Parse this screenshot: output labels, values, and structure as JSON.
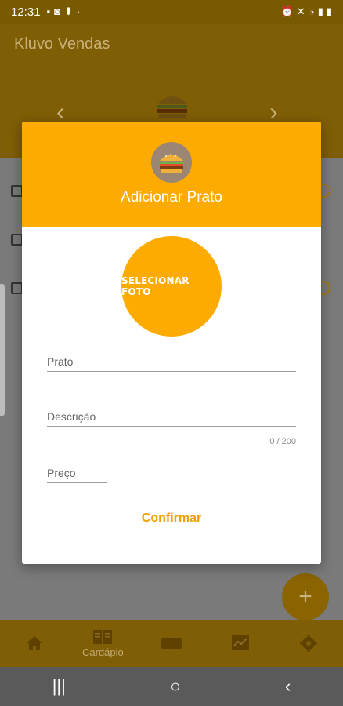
{
  "status_bar": {
    "time": "12:31"
  },
  "app": {
    "title": "Kluvo Vendas"
  },
  "bottom_nav": {
    "items": [
      {
        "icon": "home-icon",
        "label": ""
      },
      {
        "icon": "menu-book-icon",
        "label": "Cardápio"
      },
      {
        "icon": "ticket-icon",
        "label": ""
      },
      {
        "icon": "chart-icon",
        "label": ""
      },
      {
        "icon": "gear-icon",
        "label": ""
      }
    ]
  },
  "fab": {
    "label": "+"
  },
  "modal": {
    "title": "Adicionar Prato",
    "photo_button": "SELECIONAR FOTO",
    "fields": {
      "prato_placeholder": "Prato",
      "descricao_placeholder": "Descrição",
      "descricao_counter": "0 / 200",
      "preco_placeholder": "Preço"
    },
    "confirm_label": "Confirmar"
  },
  "colors": {
    "primary": "#fdab00",
    "primary_dimmed": "#7f5e05",
    "confirm_text": "#f2a100"
  }
}
